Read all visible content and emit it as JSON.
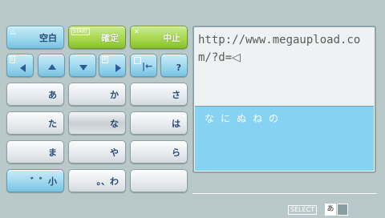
{
  "function_keys": {
    "triangle": {
      "button_icon": "triangle-button-icon",
      "label": "空白"
    },
    "start": {
      "button_tag": "START",
      "label": "確定"
    },
    "cross": {
      "button_icon": "cross-button-icon",
      "label": "中止"
    }
  },
  "nav_keys": {
    "left": {
      "button_tag": "L",
      "icon": "arrow-left-icon"
    },
    "up": {
      "icon": "arrow-up-icon"
    },
    "down": {
      "icon": "arrow-down-icon"
    },
    "right": {
      "button_tag": "R",
      "icon": "arrow-right-icon"
    },
    "backspace": {
      "button_icon": "square-button-icon",
      "icon": "backspace-icon"
    },
    "help": {
      "label": "?"
    }
  },
  "char_keys": [
    [
      "あ",
      "か",
      "さ"
    ],
    [
      "た",
      "な",
      "は"
    ],
    [
      "ま",
      "や",
      "ら"
    ],
    [
      "゛゜小",
      "。、わ",
      ""
    ]
  ],
  "selected_key": "な",
  "text_panel": {
    "url": "http://www.megaupload.com/?d=",
    "cursor_glyph": "◁",
    "input": "なにぬねの"
  },
  "status_bar": {
    "select_label": "SELECT",
    "mode": "あ"
  },
  "colors": {
    "background": "#b9c9ca",
    "blue_key": "#9fd8ee",
    "green_key": "#a8d850",
    "input_area": "#86d2f2"
  }
}
